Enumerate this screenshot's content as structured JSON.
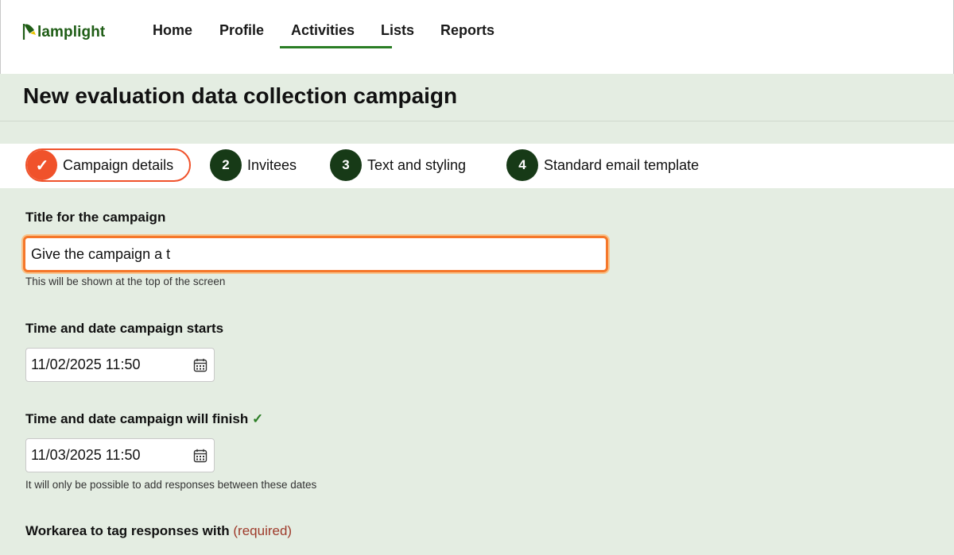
{
  "brand": {
    "name": "lamplight",
    "color": "#1f5d16"
  },
  "nav": {
    "items": [
      {
        "label": "Home",
        "active": false
      },
      {
        "label": "Profile",
        "active": false
      },
      {
        "label": "Activities",
        "active": true
      },
      {
        "label": "Lists",
        "active": false
      },
      {
        "label": "Reports",
        "active": false
      }
    ]
  },
  "page": {
    "title": "New evaluation data collection campaign"
  },
  "steps": [
    {
      "marker": "✓",
      "label": "Campaign details",
      "state": "done"
    },
    {
      "marker": "2",
      "label": "Invitees",
      "state": "pending"
    },
    {
      "marker": "3",
      "label": "Text and styling",
      "state": "pending"
    },
    {
      "marker": "4",
      "label": "Standard email template",
      "state": "pending"
    }
  ],
  "form": {
    "title_field": {
      "label": "Title for the campaign",
      "value": "Give the campaign a t",
      "hint": "This will be shown at the top of the screen"
    },
    "start_field": {
      "label": "Time and date campaign starts",
      "value": "11/02/2025 11:50",
      "icon": "calendar-icon"
    },
    "finish_field": {
      "label": "Time and date campaign will finish",
      "valid_mark": "✓",
      "value": "11/03/2025 11:50",
      "icon": "calendar-icon",
      "hint": "It will only be possible to add responses between these dates"
    },
    "workarea_field": {
      "label": "Workarea to tag responses with",
      "required_text": "(required)"
    }
  },
  "colors": {
    "accent_orange": "#f0522b",
    "nav_active": "#2a7d24",
    "step_dark": "#173a17",
    "background": "#e4ede2"
  }
}
